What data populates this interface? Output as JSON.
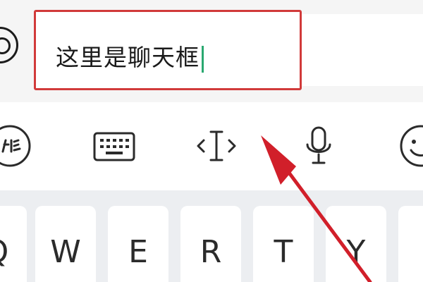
{
  "chat": {
    "input_text": "这里是聊天框",
    "caret_color": "#2aa870",
    "highlight_color": "#d13a3a"
  },
  "toolbar": {
    "icons": [
      "handwriting-icon",
      "keyboard-icon",
      "cursor-move-icon",
      "microphone-icon",
      "emoji-icon"
    ]
  },
  "keyboard": {
    "keys": [
      "Q",
      "W",
      "E",
      "R",
      "T",
      "Y"
    ]
  },
  "annotation": {
    "arrow_color": "#d11f2a"
  }
}
